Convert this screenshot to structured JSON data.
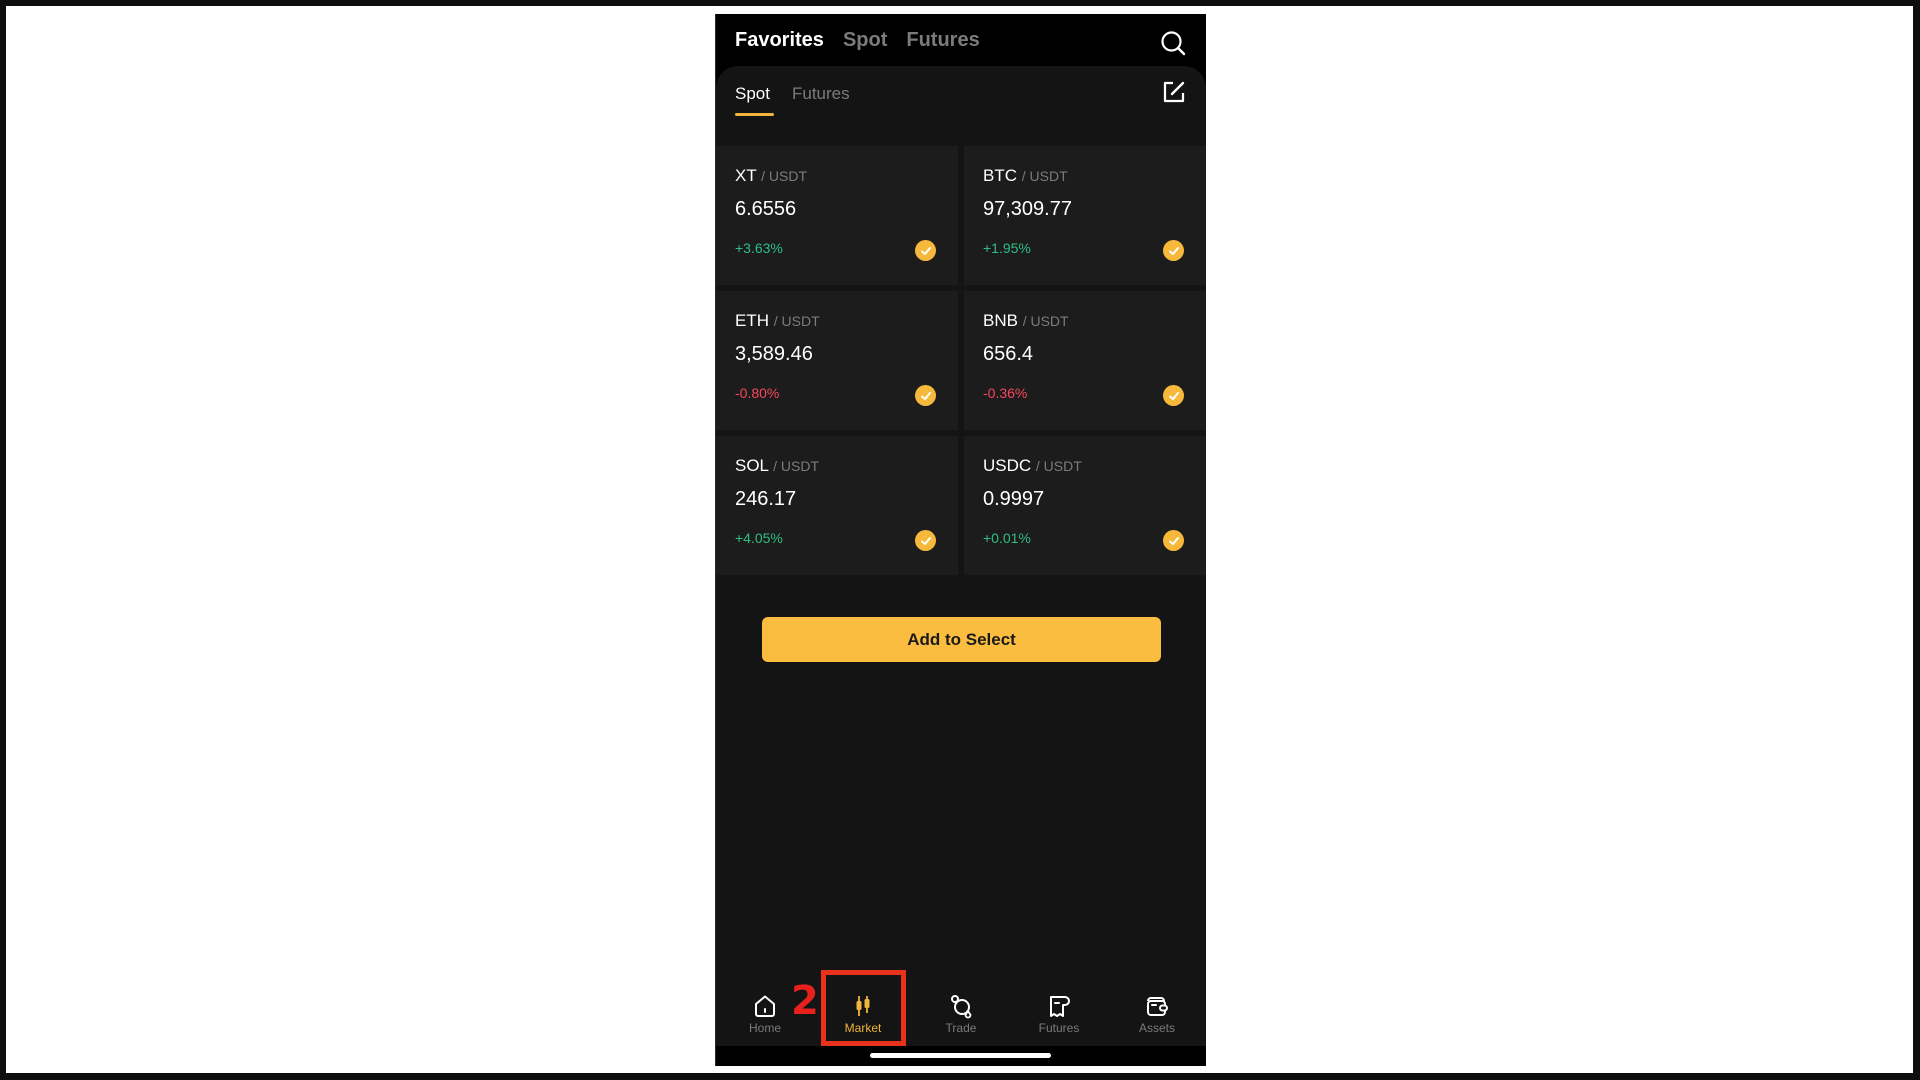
{
  "header": {
    "tabs": [
      {
        "label": "Favorites",
        "active": true
      },
      {
        "label": "Spot",
        "active": false
      },
      {
        "label": "Futures",
        "active": false
      }
    ],
    "search_icon": "search-icon"
  },
  "sub_header": {
    "tabs": [
      {
        "label": "Spot",
        "active": true
      },
      {
        "label": "Futures",
        "active": false
      }
    ],
    "edit_icon": "edit-icon"
  },
  "cards": [
    {
      "base": "XT",
      "quote": "/ USDT",
      "price": "6.6556",
      "change": "+3.63%",
      "direction": "up",
      "selected": true
    },
    {
      "base": "BTC",
      "quote": "/ USDT",
      "price": "97,309.77",
      "change": "+1.95%",
      "direction": "up",
      "selected": true
    },
    {
      "base": "ETH",
      "quote": "/ USDT",
      "price": "3,589.46",
      "change": "-0.80%",
      "direction": "down",
      "selected": true
    },
    {
      "base": "BNB",
      "quote": "/ USDT",
      "price": "656.4",
      "change": "-0.36%",
      "direction": "down",
      "selected": true
    },
    {
      "base": "SOL",
      "quote": "/ USDT",
      "price": "246.17",
      "change": "+4.05%",
      "direction": "up",
      "selected": true
    },
    {
      "base": "USDC",
      "quote": "/ USDT",
      "price": "0.9997",
      "change": "+0.01%",
      "direction": "up",
      "selected": true
    }
  ],
  "add_button": {
    "label": "Add to Select"
  },
  "bottom_nav": {
    "items": [
      {
        "label": "Home",
        "icon": "home-icon",
        "active": false
      },
      {
        "label": "Market",
        "icon": "candlestick-icon",
        "active": true
      },
      {
        "label": "Trade",
        "icon": "trade-icon",
        "active": false
      },
      {
        "label": "Futures",
        "icon": "futures-icon",
        "active": false
      },
      {
        "label": "Assets",
        "icon": "wallet-icon",
        "active": false
      }
    ]
  },
  "annotation": {
    "step_number": "2",
    "color": "#e8321c"
  },
  "colors": {
    "accent": "#f0b53a",
    "button": "#fbbd40",
    "up": "#2ebd85",
    "down": "#f6465d",
    "background": "#141414",
    "card": "#1c1c1c"
  }
}
